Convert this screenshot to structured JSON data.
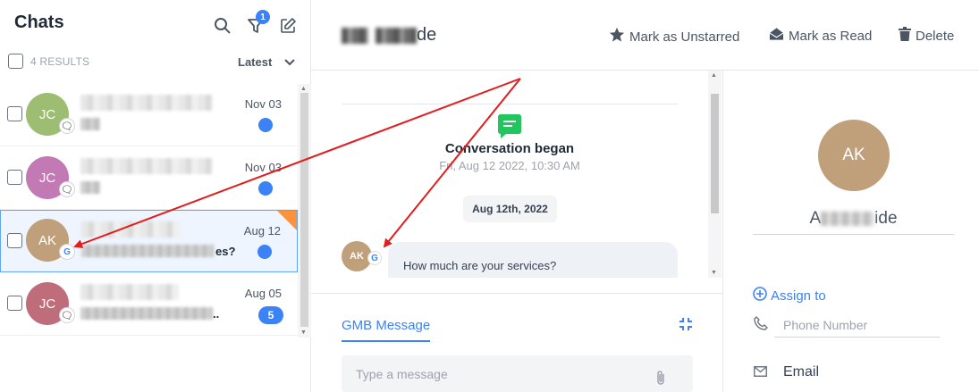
{
  "header": {
    "title": "Chats",
    "filter_badge": "1",
    "results": "4 RESULTS",
    "sort": "Latest"
  },
  "chats": [
    {
      "initials": "JC",
      "color": "#9cbd72",
      "date": "Nov 03",
      "channel_icon": "chat-icon",
      "snippet": "",
      "unread": ""
    },
    {
      "initials": "JC",
      "color": "#c379b3",
      "date": "Nov 03",
      "channel_icon": "chat-icon",
      "snippet": "",
      "unread": ""
    },
    {
      "initials": "AK",
      "color": "#bfa07a",
      "date": "Aug 12",
      "channel_icon": "google-icon",
      "snippet": "es?",
      "unread": ""
    },
    {
      "initials": "JC",
      "color": "#c06d7b",
      "date": "Aug 05",
      "channel_icon": "chat-icon",
      "snippet": "..",
      "unread": "5"
    }
  ],
  "conversation": {
    "contact_name_suffix": "de",
    "actions": {
      "unstar": "Mark as Unstarred",
      "read": "Mark as Read",
      "delete": "Delete"
    },
    "began_label": "Conversation began",
    "began_time": "Fri, Aug 12 2022, 10:30 AM",
    "date_pill": "Aug 12th, 2022",
    "message_initials": "AK",
    "message_text": "How much are your services?",
    "channel_badge": "G",
    "tab": "GMB Message",
    "compose_placeholder": "Type a message"
  },
  "profile": {
    "initials": "AK",
    "name_prefix": "A",
    "name_suffix": "ide",
    "assign": "Assign to",
    "phone_placeholder": "Phone Number",
    "email_label": "Email"
  },
  "colors": {
    "accent": "#3b82f6",
    "annotation_arrow": "#e11d1d",
    "started": "#22c55e"
  }
}
